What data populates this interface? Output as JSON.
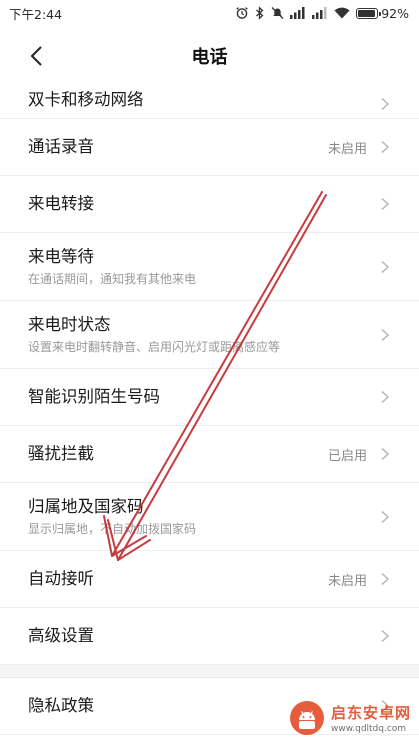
{
  "status_bar": {
    "time": "下午2:44",
    "battery_level": "92%",
    "battery_fraction": 0.92
  },
  "nav": {
    "title": "电话",
    "back_icon": "chevron-left-icon"
  },
  "settings": {
    "dual_sim": {
      "title": "双卡和移动网络"
    },
    "call_recording": {
      "title": "通话录音",
      "value": "未启用"
    },
    "call_forwarding": {
      "title": "来电转接"
    },
    "call_waiting": {
      "title": "来电等待",
      "subtitle": "在通话期间，通知我有其他来电"
    },
    "incoming_call_status": {
      "title": "来电时状态",
      "subtitle": "设置来电时翻转静音、启用闪光灯或距离感应等"
    },
    "smart_caller_id": {
      "title": "智能识别陌生号码"
    },
    "harassment_block": {
      "title": "骚扰拦截",
      "value": "已启用"
    },
    "location_country_code": {
      "title": "归属地及国家码",
      "subtitle": "显示归属地，不自动加拨国家码"
    },
    "auto_answer": {
      "title": "自动接听",
      "value": "未启用"
    },
    "advanced": {
      "title": "高级设置"
    },
    "privacy": {
      "title": "隐私政策"
    }
  },
  "watermark": {
    "brand": "启东安卓网",
    "url": "www.qdltdq.com"
  },
  "colors": {
    "annotation_arrow": "#c0272d",
    "watermark_brand": "#e0421b"
  }
}
